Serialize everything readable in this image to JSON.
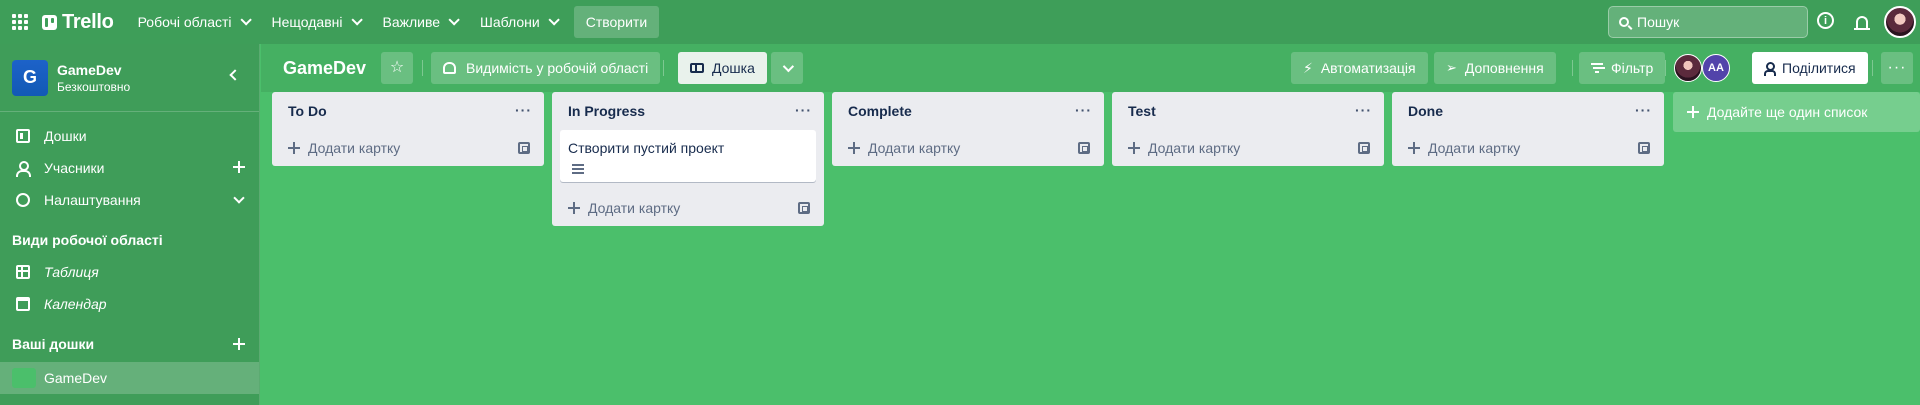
{
  "nav": {
    "logo": "Trello",
    "menus": [
      "Робочі області",
      "Нещодавні",
      "Важливе",
      "Шаблони"
    ],
    "create": "Створити",
    "search_placeholder": "Пошук",
    "info_glyph": "i"
  },
  "sidebar": {
    "workspace_initial": "G",
    "workspace_name": "GameDev",
    "workspace_plan": "Безкоштовно",
    "items": [
      {
        "label": "Дошки",
        "icon": "board-icon"
      },
      {
        "label": "Учасники",
        "icon": "members-icon"
      },
      {
        "label": "Налаштування",
        "icon": "gear-icon"
      }
    ],
    "views_title": "Види робочої області",
    "views": [
      {
        "label": "Таблиця",
        "icon": "table-icon"
      },
      {
        "label": "Календар",
        "icon": "calendar-icon"
      }
    ],
    "boards_title": "Ваші дошки",
    "boards": [
      {
        "label": "GameDev"
      }
    ]
  },
  "board": {
    "title": "GameDev",
    "visibility": "Видимість у робочій області",
    "view": "Дошка",
    "automation": "Автоматизація",
    "powerups": "Доповнення",
    "filter": "Фільтр",
    "member_initials": "AA",
    "share": "Поділитися",
    "add_list": "Додайте ще один список",
    "add_card": "Додати картку",
    "lists": [
      {
        "title": "To Do",
        "cards": []
      },
      {
        "title": "In Progress",
        "cards": [
          {
            "title": "Створити пустий проект",
            "has_description": true
          }
        ]
      },
      {
        "title": "Complete",
        "cards": []
      },
      {
        "title": "Test",
        "cards": []
      },
      {
        "title": "Done",
        "cards": []
      }
    ]
  },
  "colors": {
    "background": "#4bbf6b",
    "topnav": "#3e9e59",
    "sidebar": "#3f9d59",
    "list": "#ebecf0",
    "workspace_logo": "#1d62c9"
  }
}
